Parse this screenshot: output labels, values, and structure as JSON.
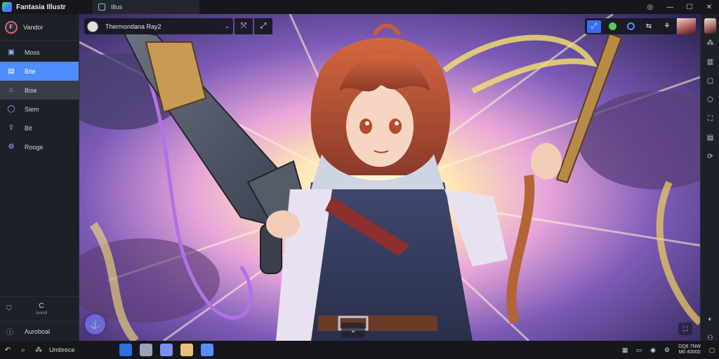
{
  "window": {
    "app_title": "Fantasia Illustr",
    "tab_label": "Illus",
    "controls": {
      "account_icon": "user-circle-icon",
      "minimize": "—",
      "maximize": "☐",
      "close": "✕"
    }
  },
  "sidebar": {
    "profile_initial": "F",
    "profile_name": "Vandor",
    "items": [
      {
        "label": "Moss",
        "icon": "▣"
      },
      {
        "label": "Bite",
        "icon": "▤"
      },
      {
        "label": "Bise",
        "icon": "⌂"
      },
      {
        "label": "Siem",
        "icon": "◯"
      },
      {
        "label": "Bit",
        "icon": "⇪"
      },
      {
        "label": "Rooge",
        "icon": "⚙"
      }
    ],
    "mini_action_label": "Iconol",
    "account_label": "Auroboal"
  },
  "toolbar": {
    "title": "Thermondana Ray2",
    "chevron": "⌄",
    "tool_a": "⤧",
    "tool_b": "⤢"
  },
  "right_tools": {
    "items": [
      "⤢",
      "●",
      "◎",
      "⇆",
      "⚘"
    ]
  },
  "right_rail": {
    "icons": [
      "⁂",
      "▥",
      "▢",
      "⬡",
      "⛶",
      "▤",
      "⟳",
      "◐",
      "⚇"
    ]
  },
  "canvas": {
    "fab_icon": "⚓",
    "scroll_icon": "⌄",
    "corner_icon": "⛶"
  },
  "taskbar": {
    "label": "Umbrece",
    "clock_line1": "DQ8 7NW",
    "clock_line2": "M0 40000",
    "apps": [
      {
        "color": "#2f6fe0"
      },
      {
        "color": "#9aa4b3"
      },
      {
        "color": "#7e8df0"
      },
      {
        "color": "#e8c07a"
      },
      {
        "color": "#5b8cff"
      }
    ]
  },
  "colors": {
    "accent": "#4d8dff",
    "sidebar_bg": "#1e2027",
    "titlebar_bg": "#15171c",
    "fab": "#6f66d9"
  }
}
